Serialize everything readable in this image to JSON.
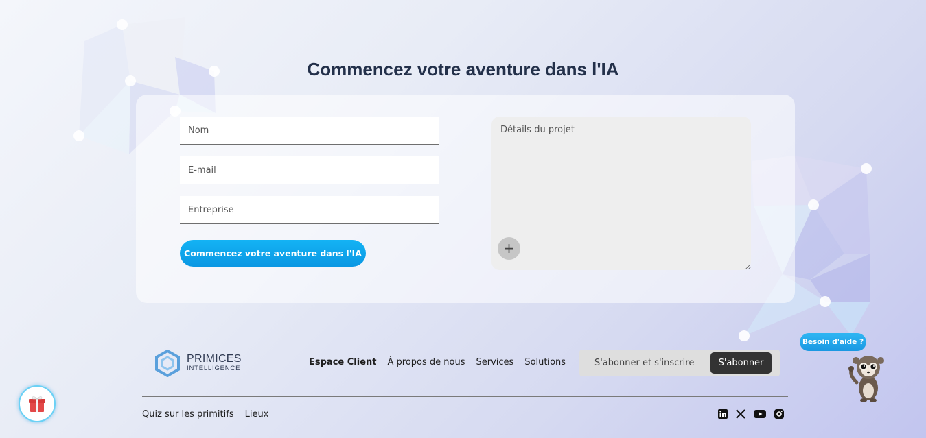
{
  "contact_section": {
    "title": "Commencez votre aventure dans l'IA",
    "fields": {
      "name_placeholder": "Nom",
      "email_placeholder": "E-mail",
      "company_placeholder": "Entreprise",
      "details_placeholder": "Détails du projet"
    },
    "submit_label": "Commencez votre aventure dans l'IA",
    "attach_label": "+"
  },
  "footer": {
    "logo": {
      "name": "PRIMICES",
      "subtitle": "INTELLIGENCE"
    },
    "nav": [
      {
        "label": "Espace Client"
      },
      {
        "label": "À propos de nous"
      },
      {
        "label": "Services"
      },
      {
        "label": "Solutions"
      }
    ],
    "subscribe": {
      "placeholder": "S'abonner et s'inscrire",
      "button_label": "S'abonner"
    },
    "bottom_links": [
      {
        "label": "Quiz sur les primitifs"
      },
      {
        "label": "Lieux"
      }
    ],
    "socials": [
      "linkedin-icon",
      "x-icon",
      "youtube-icon",
      "instagram-icon"
    ]
  },
  "widgets": {
    "help_label": "Besoin d'aide ?"
  },
  "colors": {
    "title": "#23304a",
    "accent": "#0a97e3",
    "dark_button": "#333333"
  }
}
